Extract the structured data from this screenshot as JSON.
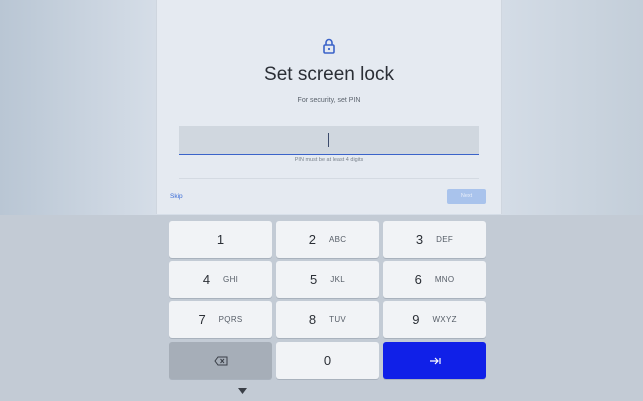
{
  "dialog": {
    "title": "Set screen lock",
    "subtitle": "For security, set PIN",
    "pin_value": "",
    "hint": "PIN must be at least 4 digits",
    "skip_label": "Skip",
    "next_label": "Next",
    "lock_icon": "lock-icon"
  },
  "keypad": {
    "keys": [
      {
        "digit": "1",
        "letters": ""
      },
      {
        "digit": "2",
        "letters": "ABC"
      },
      {
        "digit": "3",
        "letters": "DEF"
      },
      {
        "digit": "4",
        "letters": "GHI"
      },
      {
        "digit": "5",
        "letters": "JKL"
      },
      {
        "digit": "6",
        "letters": "MNO"
      },
      {
        "digit": "7",
        "letters": "PQRS"
      },
      {
        "digit": "8",
        "letters": "TUV"
      },
      {
        "digit": "9",
        "letters": "WXYZ"
      }
    ],
    "zero": "0",
    "backspace_icon": "backspace-icon",
    "enter_icon": "tab-enter-icon",
    "enter_color": "#1020e8"
  },
  "nav": {
    "hide_keyboard_icon": "chevron-down-icon"
  },
  "colors": {
    "accent": "#3a6bd6",
    "field_underline": "#3b63c9"
  }
}
